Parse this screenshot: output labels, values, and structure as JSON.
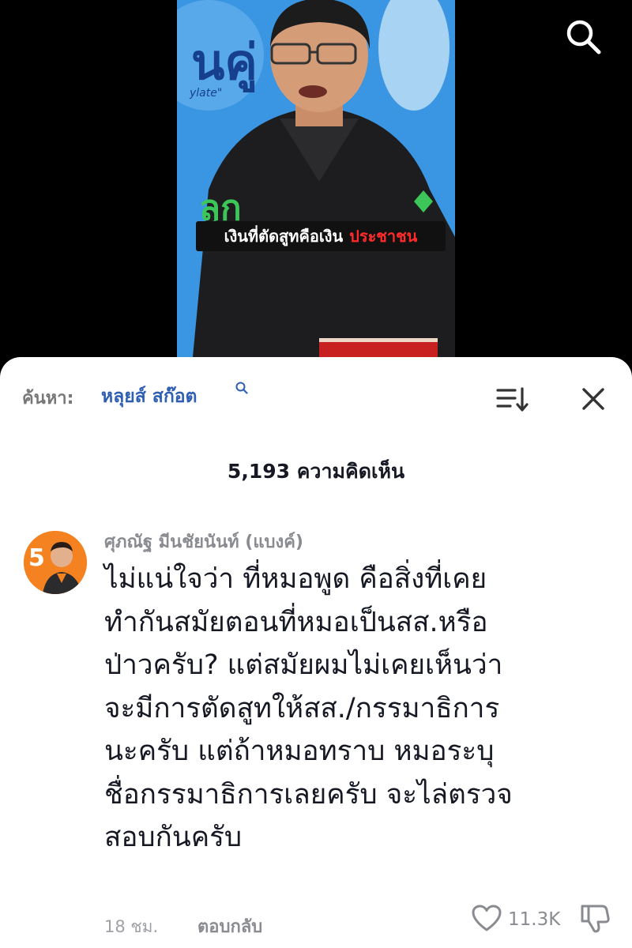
{
  "video": {
    "caption_white": "เงินที่ตัดสูทคือเงิน",
    "caption_red": "ประชาชน",
    "backdrop_text": "นคู่",
    "backdrop_sub": "ylate\"",
    "colors": {
      "backdrop": "#3d9be6",
      "caption_bg": "#111111",
      "caption_red": "#ff2b2b"
    }
  },
  "top_bar": {
    "search_icon": "search-icon"
  },
  "comments_panel": {
    "search_label": "ค้นหา:",
    "search_term": "หลุยส์ สก๊อต",
    "sort_icon": "sort-icon",
    "close_icon": "close-icon",
    "comment_count": "5,193 ความคิดเห็น",
    "comments": [
      {
        "author": "ศุภณัฐ มีนชัยนันท์ (แบงค์)",
        "avatar_badge": "5",
        "text_lines": [
          "ไม่แน่ใจว่า ที่หมอพูด คือสิ่งที่เคย",
          "ทำกันสมัยตอนที่หมอเป็นสส.หรือ",
          "ป่าวครับ? แต่สมัยผมไม่เคยเห็นว่า",
          "จะมีการตัดสูทให้สส./กรรมาธิการ",
          "นะครับ แต่ถ้าหมอทราบ หมอระบุ",
          "ชื่อกรรมาธิการเลยครับ จะไล่ตรวจ",
          "สอบกันครับ"
        ],
        "time": "18 ชม.",
        "reply_label": "ตอบกลับ",
        "like_count": "11.3K"
      }
    ]
  },
  "colors": {
    "link_blue": "#2f5fb3",
    "muted": "#8a8b91",
    "text": "#161823",
    "avatar_orange": "#f58220"
  }
}
